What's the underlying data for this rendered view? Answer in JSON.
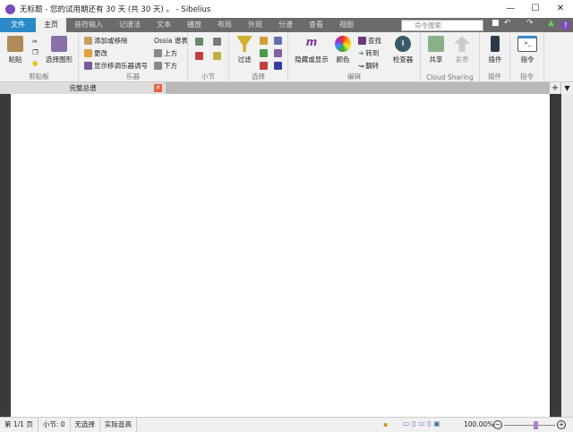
{
  "window": {
    "title": "无标题 - 您的试用期还有 30 天 (共 30 天) 。 - Sibelius",
    "minimize": "—",
    "maximize": "☐",
    "close": "✕"
  },
  "tabs": [
    "文件",
    "主页",
    "音符输入",
    "记谱法",
    "文本",
    "播放",
    "布局",
    "外观",
    "分谱",
    "查看",
    "视图"
  ],
  "search": {
    "placeholder": "命令搜索"
  },
  "ribbon": {
    "clipboard": {
      "paste": "粘贴",
      "select_graphic": "选择图形",
      "label": "剪贴板"
    },
    "instruments": {
      "add_remove": "添加或移除",
      "change": "更改",
      "show_transposing": "显示移调乐器调号",
      "ossia": "Ossia 谱表",
      "above": "上方",
      "below": "下方",
      "label": "乐器"
    },
    "bars": {
      "label": "小节"
    },
    "select": {
      "filter": "过滤",
      "label": "选择"
    },
    "edit": {
      "hide_show": "隐藏或显示",
      "color": "颜色",
      "find": "查找",
      "goto": "转到",
      "flip": "翻转",
      "inspector": "检查器",
      "label": "编辑"
    },
    "cloud": {
      "share": "共享",
      "publish": "发表",
      "label": "Cloud Sharing"
    },
    "plugins": {
      "plugins": "插件",
      "label": "插件"
    },
    "commands": {
      "commands": "指令",
      "label": "指令"
    }
  },
  "document_tab": {
    "label": "完整总谱",
    "close": "✕"
  },
  "status": {
    "page": "第 1/1 页",
    "bar": "小节: 0",
    "selection": "无选择",
    "concert_pitch": "实际音高",
    "zoom": "100.00%"
  },
  "zoom_level": 0.6
}
